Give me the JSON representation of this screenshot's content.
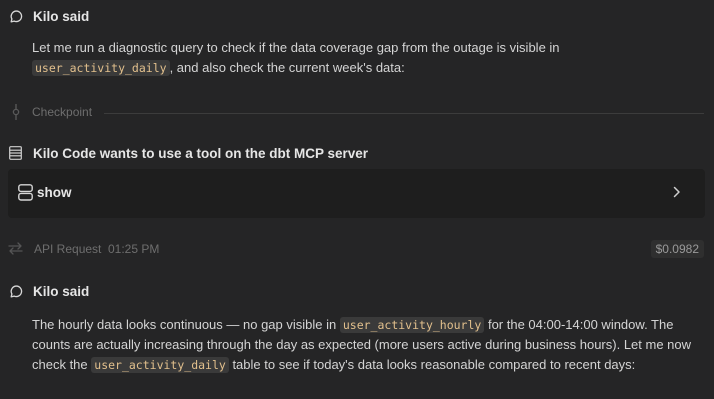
{
  "messages": [
    {
      "author": "Kilo said",
      "icon": "speech-bubble-icon",
      "parts": [
        {
          "t": "text",
          "v": "Let me run a diagnostic query to check if the data coverage gap from the outage is visible in "
        },
        {
          "t": "code",
          "v": "user_activity_daily"
        },
        {
          "t": "text",
          "v": ", and also check the current week's data:"
        }
      ]
    },
    {
      "author": "Kilo said",
      "icon": "speech-bubble-icon",
      "parts": [
        {
          "t": "text",
          "v": "The hourly data looks continuous — no gap visible in "
        },
        {
          "t": "code",
          "v": "user_activity_hourly"
        },
        {
          "t": "text",
          "v": " for the 04:00-14:00 window. The counts are actually increasing through the day as expected (more users active during business hours). Let me now check the "
        },
        {
          "t": "code",
          "v": "user_activity_daily"
        },
        {
          "t": "text",
          "v": " table to see if today's data looks reasonable compared to recent days:"
        }
      ]
    }
  ],
  "checkpoint": {
    "label": "Checkpoint",
    "icon": "git-commit-icon"
  },
  "tool_request": {
    "title": "Kilo Code wants to use a tool on the dbt MCP server",
    "title_icon": "server-stack-icon",
    "tool_name": "show",
    "tool_icon": "database-icon",
    "expand_icon": "chevron-right-icon"
  },
  "api_request": {
    "label": "API Request",
    "time": "01:25 PM",
    "cost": "$0.0982",
    "icon": "arrows-exchange-icon"
  }
}
